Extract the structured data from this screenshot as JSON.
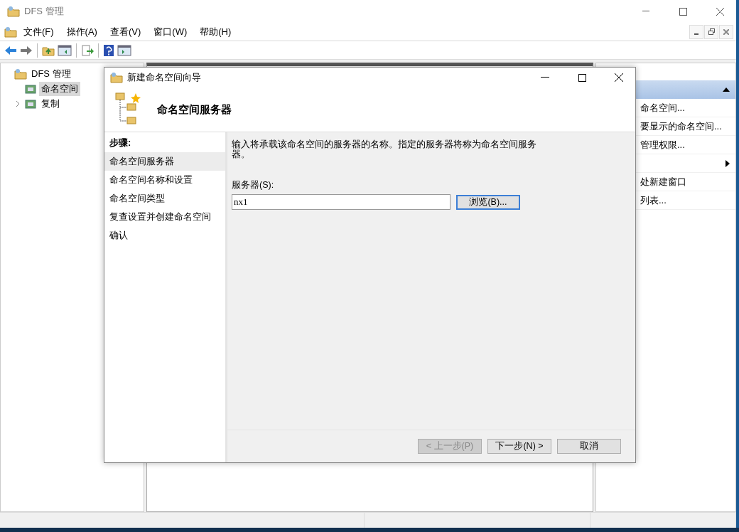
{
  "window": {
    "title": "DFS 管理"
  },
  "menu": [
    {
      "label": "文件(F)"
    },
    {
      "label": "操作(A)"
    },
    {
      "label": "查看(V)"
    },
    {
      "label": "窗口(W)"
    },
    {
      "label": "帮助(H)"
    }
  ],
  "tree": [
    {
      "label": "DFS 管理",
      "selected": false,
      "children": [
        {
          "label": "命名空间",
          "selected": true,
          "expandable": false
        },
        {
          "label": "复制",
          "selected": false,
          "expandable": true
        }
      ]
    }
  ],
  "actions": [
    {
      "kind": "header"
    },
    {
      "kind": "item",
      "label": "命名空间..."
    },
    {
      "kind": "item",
      "label": "要显示的命名空间..."
    },
    {
      "kind": "item",
      "label": "管理权限..."
    },
    {
      "kind": "submenu"
    },
    {
      "kind": "item",
      "label": "处新建窗口"
    },
    {
      "kind": "item",
      "label": "列表..."
    }
  ],
  "dialog": {
    "title": "新建命名空间向导",
    "heading": "命名空间服务器",
    "steps_title": "步骤:",
    "steps": [
      {
        "label": "命名空间服务器",
        "selected": true
      },
      {
        "label": "命名空间名称和设置",
        "selected": false
      },
      {
        "label": "命名空间类型",
        "selected": false
      },
      {
        "label": "复查设置并创建命名空间",
        "selected": false
      },
      {
        "label": "确认",
        "selected": false
      }
    ],
    "description": "输入将承载该命名空间的服务器的名称。指定的服务器将称为命名空间服务器。",
    "server_label": "服务器(S):",
    "server_value": "nx1",
    "browse_button": {
      "label": "浏览(B)...",
      "focused": true
    },
    "buttons": [
      {
        "label": "< 上一步(P)",
        "disabled": true
      },
      {
        "label": "下一步(N) >",
        "disabled": false
      },
      {
        "label": "取消",
        "disabled": false
      }
    ]
  }
}
